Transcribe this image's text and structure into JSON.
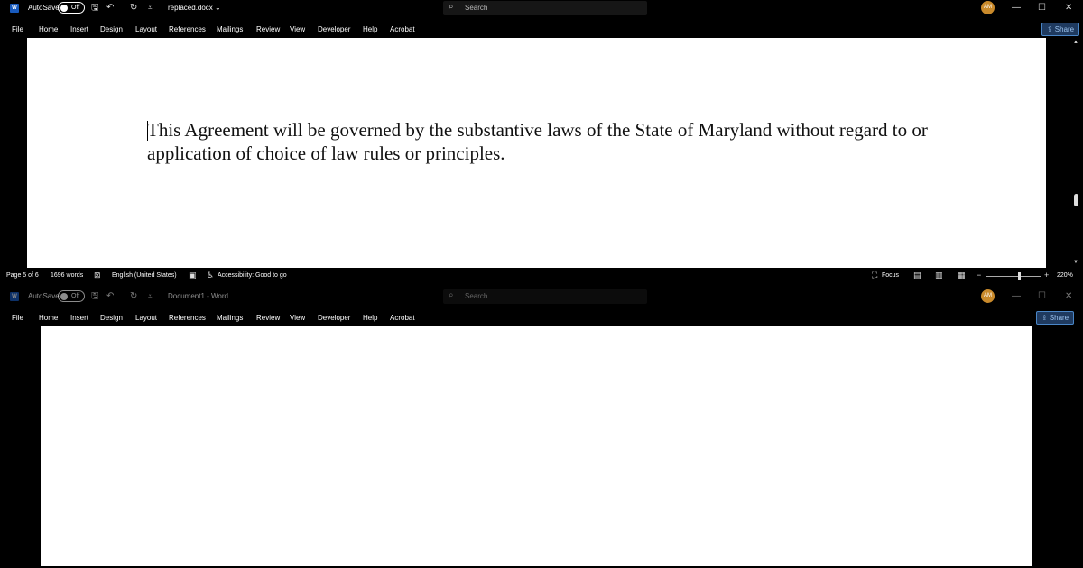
{
  "windows": [
    {
      "autosave_label": "AutoSave",
      "toggle_state": "Off",
      "doc_title": "replaced.docx",
      "doc_title_chevron": "⌄",
      "search_placeholder": "Search",
      "avatar_initials": "AM",
      "menu": [
        "File",
        "Home",
        "Insert",
        "Design",
        "Layout",
        "References",
        "Mailings",
        "Review",
        "View",
        "Developer",
        "Help",
        "Acrobat"
      ],
      "share_label": "Share",
      "body_text": "This Agreement will be governed by the substantive laws of the State of Maryland without regard to or application of choice of law rules or principles.",
      "status": {
        "page": "Page 5 of 6",
        "words": "1696 words",
        "language": "English (United States)",
        "accessibility": "Accessibility: Good to go",
        "focus": "Focus",
        "zoom": "220%"
      }
    },
    {
      "autosave_label": "AutoSave",
      "toggle_state": "Off",
      "doc_title": "Document1  -  Word",
      "search_placeholder": "Search",
      "avatar_initials": "AM",
      "menu": [
        "File",
        "Home",
        "Insert",
        "Design",
        "Layout",
        "References",
        "Mailings",
        "Review",
        "View",
        "Developer",
        "Help",
        "Acrobat"
      ],
      "share_label": "Share"
    }
  ],
  "icons": {
    "word_logo": "W",
    "save": "🖫",
    "undo": "↶",
    "redo": "↻",
    "customize": "⩡",
    "search": "⌕",
    "minimize": "—",
    "restore": "☐",
    "close": "✕",
    "share": "⇪",
    "spelling": "⊠",
    "macro": "▣",
    "accessibility": "♿",
    "focus": "⛶",
    "read_mode": "▤",
    "print_layout": "▥",
    "web_layout": "▦",
    "zoom_out": "−",
    "zoom_in": "+"
  },
  "colors": {
    "background": "#000000",
    "page": "#ffffff",
    "avatar": "#c98a2b",
    "word_blue": "#185abd",
    "share_border": "#4a86c7"
  }
}
